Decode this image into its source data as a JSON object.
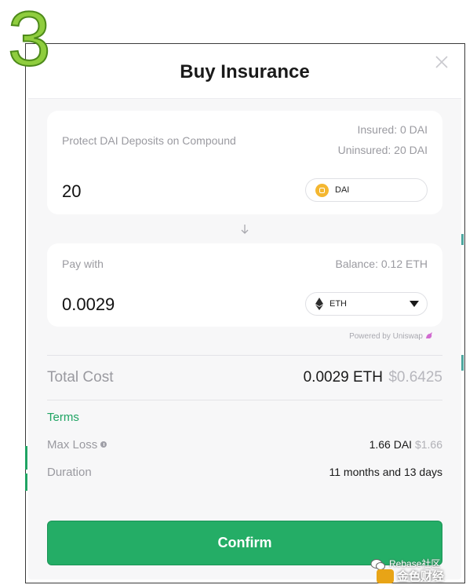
{
  "step_number": "3",
  "modal": {
    "title": "Buy Insurance"
  },
  "protect": {
    "label": "Protect DAI Deposits on Compound",
    "insured": "Insured: 0 DAI",
    "uninsured": "Uninsured: 20 DAI",
    "amount": "20",
    "token": "DAI"
  },
  "pay": {
    "label": "Pay with",
    "balance": "Balance: 0.12 ETH",
    "amount": "0.0029",
    "token": "ETH",
    "powered_by": "Powered by Uniswap"
  },
  "total": {
    "label": "Total Cost",
    "eth": "0.0029 ETH",
    "usd": "$0.6425"
  },
  "terms": {
    "heading": "Terms",
    "max_loss_label": "Max Loss",
    "max_loss_value": "1.66 DAI",
    "max_loss_usd": "$1.66",
    "duration_label": "Duration",
    "duration_value": "11 months and 13 days"
  },
  "confirm_label": "Confirm",
  "watermark": {
    "line1": "Rebase社区",
    "line2": "金色财经"
  },
  "colors": {
    "accent_green": "#24ad66",
    "step_green": "#8fcd3e",
    "dai_orange": "#f4b731"
  },
  "icons": {
    "close": "close-icon",
    "arrow": "arrow-down-icon",
    "dai": "dai-token-icon",
    "eth": "eth-token-icon",
    "dropdown": "chevron-down-icon",
    "info": "info-icon",
    "uniswap": "unicorn-icon"
  }
}
